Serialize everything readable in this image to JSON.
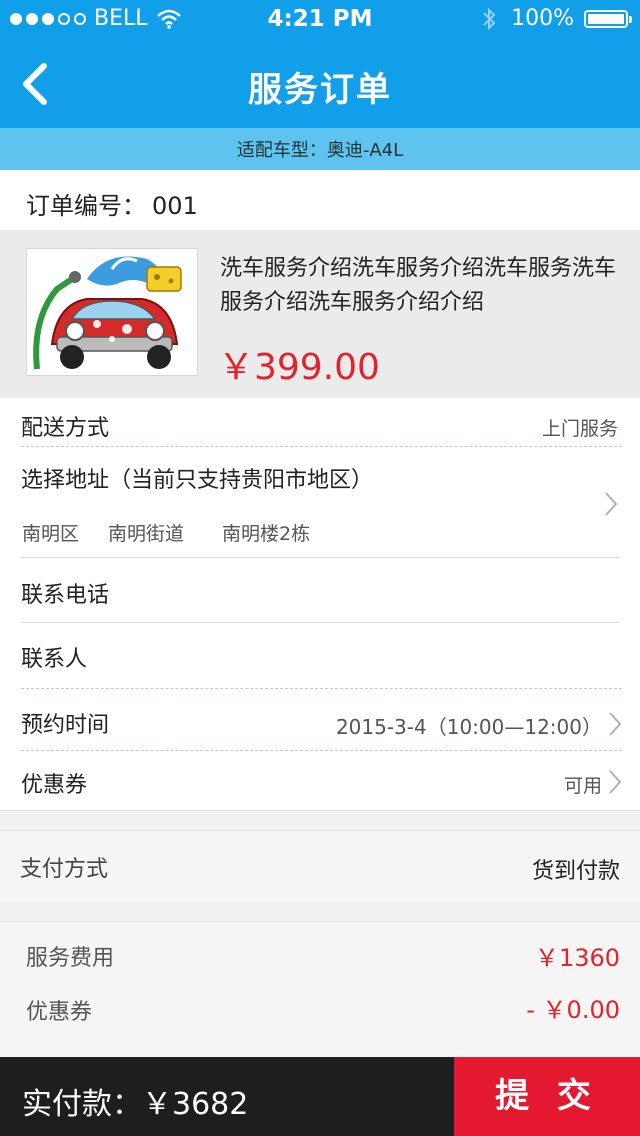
{
  "status_bar": {
    "carrier": "BELL",
    "time": "4:21 PM",
    "battery": "100%"
  },
  "nav": {
    "title": "服务订单"
  },
  "car_bar": {
    "text": "适配车型：奥迪-A4L"
  },
  "order": {
    "label": "订单编号：",
    "number": "001"
  },
  "product": {
    "description": "洗车服务介绍洗车服务介绍洗车服务洗车服务介绍洗车服务介绍介绍",
    "price": "￥399.00"
  },
  "delivery": {
    "label": "配送方式",
    "value": "上门服务"
  },
  "address": {
    "label": "选择地址（当前只支持贵阳市地区）",
    "district": "南明区",
    "street": "南明街道",
    "building": "南明楼2栋"
  },
  "phone": {
    "label": "联系电话"
  },
  "contact": {
    "label": "联系人"
  },
  "appointment": {
    "label": "预约时间",
    "value": "2015-3-4（10:00—12:00）"
  },
  "coupon": {
    "label": "优惠券",
    "value": "可用"
  },
  "payment": {
    "label": "支付方式",
    "value": "货到付款"
  },
  "fees": {
    "service_label": "服务费用",
    "service_value": "￥1360",
    "coupon_label": "优惠券",
    "coupon_value": "- ￥0.00"
  },
  "bottom": {
    "total_label": "实付款：￥3682",
    "submit_label": "提 交"
  },
  "colors": {
    "primary": "#119fea",
    "car_bar": "#5ec3ef",
    "price_red": "#e3232b",
    "submit": "#e4192f",
    "bottom_bar": "#1e1e1e"
  }
}
